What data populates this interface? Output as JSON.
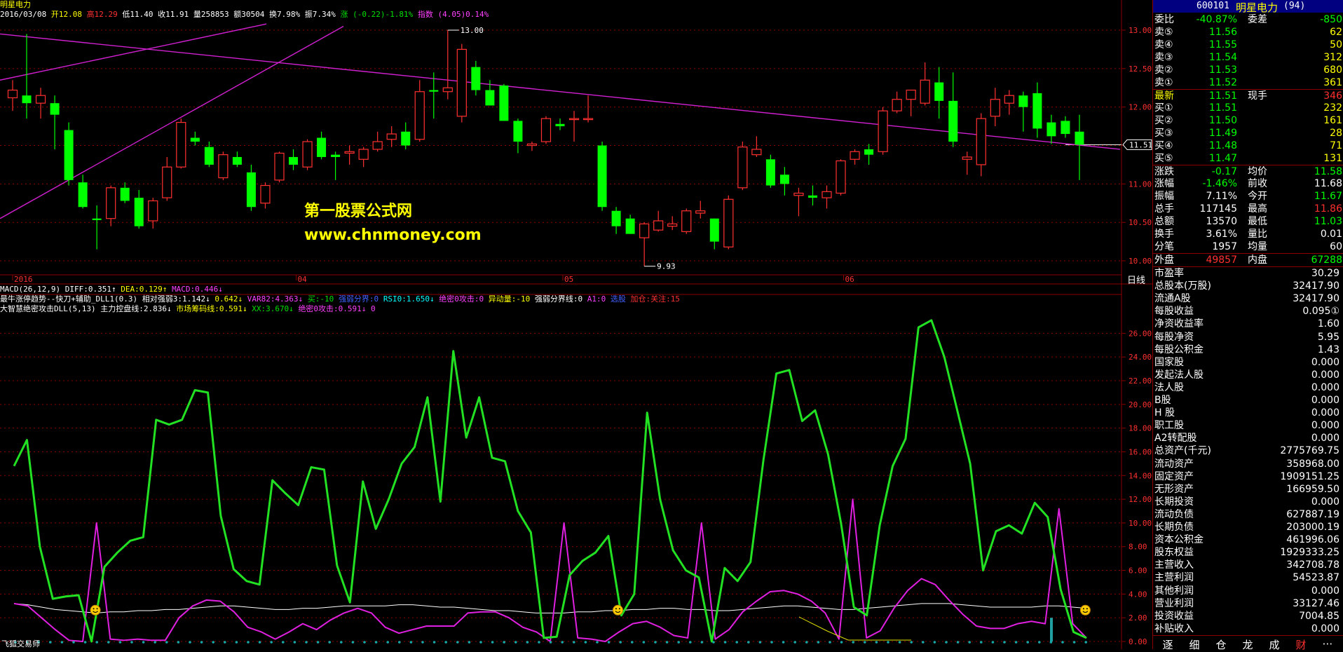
{
  "window": {
    "title": "明星电力"
  },
  "ohlc": {
    "date": "2016/03/08",
    "open_label": "开",
    "open": "12.08",
    "high_label": "高",
    "high": "12.29",
    "low_label": "低",
    "low": "11.40",
    "close_label": "收",
    "close": "11.91",
    "vol_label": "量",
    "vol": "258853",
    "amt_label": "额",
    "amt": "30504",
    "turn_label": "换",
    "turn": "7.98%",
    "amp_label": "振",
    "amp": "7.34%",
    "chg": "涨 (-0.22)-1.81%",
    "idx": "指数 (4.05)0.14%"
  },
  "overlay": {
    "line1": "第一股票公式网",
    "line2": "www.chnmoney.com"
  },
  "price_axis": {
    "ticks": [
      "13.00",
      "12.50",
      "12.00",
      "11.50",
      "11.00",
      "10.50",
      "10.00"
    ],
    "current": "11.51",
    "peak_label": "13.00",
    "trough_label": "9.93",
    "period": "日线"
  },
  "date_axis": [
    "2016",
    "04",
    "05",
    "06"
  ],
  "indicator_rows": {
    "macd": [
      "MACD(26,12,9)",
      "DIFF:0.351↑",
      "DEA:0.129↑",
      "MACD:0.446↓"
    ],
    "row2": [
      "最牛涨停趋势--快刀+辅助_DLL1(0.3)",
      "相对强弱3:1.142↓",
      "0.642↓",
      "VAR82:4.363↓",
      "买:-10",
      "强弱分界:0",
      "RSI0:1.650↓",
      "绝密0攻击:0",
      "异动量:-10",
      "强弱分界线:0",
      "A1:0",
      "选股",
      "加仓:关注:15"
    ],
    "row3": [
      "大智慧绝密攻击DLL(5,13)",
      "主力控盘线:2.836↓",
      "市场筹码线:0.591↓",
      "XX:3.670↓",
      "绝密0攻击:0.591↓",
      "0"
    ]
  },
  "sub_axis": [
    "26.00",
    "24.00",
    "22.00",
    "20.00",
    "18.00",
    "16.00",
    "14.00",
    "12.00",
    "10.00",
    "8.00",
    "6.00",
    "4.00",
    "2.00",
    "0.00"
  ],
  "footer_left": "飞狐交易师",
  "panel": {
    "code": "600101",
    "name": "明星电力",
    "count": "(94)",
    "ratio_label": "委比",
    "ratio": "-40.87%",
    "diff_label": "委差",
    "diff": "-850",
    "sell": [
      {
        "label": "卖⑤",
        "price": "11.56",
        "vol": "62"
      },
      {
        "label": "卖④",
        "price": "11.55",
        "vol": "50"
      },
      {
        "label": "卖③",
        "price": "11.54",
        "vol": "312"
      },
      {
        "label": "卖②",
        "price": "11.53",
        "vol": "680"
      },
      {
        "label": "卖①",
        "price": "11.52",
        "vol": "361"
      }
    ],
    "latest_label": "最新",
    "latest": "11.51",
    "now_label": "现手",
    "now": "346",
    "buy": [
      {
        "label": "买①",
        "price": "11.51",
        "vol": "232"
      },
      {
        "label": "买②",
        "price": "11.50",
        "vol": "161"
      },
      {
        "label": "买③",
        "price": "11.49",
        "vol": "28"
      },
      {
        "label": "买④",
        "price": "11.48",
        "vol": "71"
      },
      {
        "label": "买⑤",
        "price": "11.47",
        "vol": "131"
      }
    ],
    "stats": [
      {
        "l1": "涨跌",
        "v1": "-0.17",
        "c1": "#00ff00",
        "l2": "均价",
        "v2": "11.58",
        "c2": "#00ff00"
      },
      {
        "l1": "涨幅",
        "v1": "-1.46%",
        "c1": "#00ff00",
        "l2": "前收",
        "v2": "11.68",
        "c2": "#ffffff"
      },
      {
        "l1": "振幅",
        "v1": "7.11%",
        "c1": "#ffffff",
        "l2": "今开",
        "v2": "11.67",
        "c2": "#00ff00"
      },
      {
        "l1": "总手",
        "v1": "117145",
        "c1": "#ffffff",
        "l2": "最高",
        "v2": "11.86",
        "c2": "#ff3030"
      },
      {
        "l1": "总额",
        "v1": "13570",
        "c1": "#ffffff",
        "l2": "最低",
        "v2": "11.03",
        "c2": "#00ff00"
      },
      {
        "l1": "换手",
        "v1": "3.61%",
        "c1": "#ffffff",
        "l2": "量比",
        "v2": "0.01",
        "c2": "#ffffff"
      },
      {
        "l1": "分笔",
        "v1": "1957",
        "c1": "#ffffff",
        "l2": "均量",
        "v2": "60",
        "c2": "#ffffff"
      }
    ],
    "outer_label": "外盘",
    "outer": "49857",
    "inner_label": "内盘",
    "inner": "67288",
    "fundamentals": [
      {
        "label": "市盈率",
        "value": "30.29"
      },
      {
        "label": "总股本(万股)",
        "value": "32417.90"
      },
      {
        "label": "流通A股",
        "value": "32417.90"
      },
      {
        "label": "每股收益",
        "value": "0.095①"
      },
      {
        "label": "净资收益率",
        "value": "1.60"
      },
      {
        "label": "每股净资",
        "value": "5.95"
      },
      {
        "label": "每股公积金",
        "value": "1.43"
      },
      {
        "label": "国家股",
        "value": "0.000"
      },
      {
        "label": "发起法人股",
        "value": "0.000"
      },
      {
        "label": "法人股",
        "value": "0.000"
      },
      {
        "label": "B股",
        "value": "0.000"
      },
      {
        "label": "H 股",
        "value": "0.000"
      },
      {
        "label": "职工股",
        "value": "0.000"
      },
      {
        "label": "A2转配股",
        "value": "0.000"
      },
      {
        "label": "总资产(千元)",
        "value": "2775769.75"
      },
      {
        "label": "流动资产",
        "value": "358968.00"
      },
      {
        "label": "固定资产",
        "value": "1909151.25"
      },
      {
        "label": "无形资产",
        "value": "166959.50"
      },
      {
        "label": "长期投资",
        "value": "0.000"
      },
      {
        "label": "流动负债",
        "value": "627887.19"
      },
      {
        "label": "长期负债",
        "value": "203000.19"
      },
      {
        "label": "资本公积金",
        "value": "461996.06"
      },
      {
        "label": "股东权益",
        "value": "1929333.25"
      },
      {
        "label": "主营收入",
        "value": "342708.78"
      },
      {
        "label": "主营利润",
        "value": "54523.87"
      },
      {
        "label": "其他利润",
        "value": "0.000"
      },
      {
        "label": "营业利润",
        "value": "33127.46"
      },
      {
        "label": "投资收益",
        "value": "7004.85"
      },
      {
        "label": "补贴收入",
        "value": "0.000"
      }
    ],
    "tabs": [
      "逐",
      "细",
      "仓",
      "龙",
      "成",
      "财",
      "⋯"
    ]
  },
  "colors": {
    "up": "#ff3030",
    "down": "#00ff00",
    "bg": "#000000",
    "grid": "#8b0000",
    "magenta": "#d020d0",
    "accent": "#ffff00"
  },
  "chart_data": [
    {
      "type": "candlestick",
      "ylim": [
        9.9,
        13.1
      ],
      "candles": [
        {
          "o": 12.12,
          "h": 12.35,
          "l": 11.95,
          "c": 12.22
        },
        {
          "o": 12.15,
          "h": 12.95,
          "l": 11.85,
          "c": 12.05
        },
        {
          "o": 12.05,
          "h": 12.25,
          "l": 11.85,
          "c": 12.15
        },
        {
          "o": 12.05,
          "h": 12.15,
          "l": 11.45,
          "c": 11.9
        },
        {
          "o": 11.7,
          "h": 11.8,
          "l": 10.98,
          "c": 11.05
        },
        {
          "o": 11.02,
          "h": 11.12,
          "l": 10.68,
          "c": 10.7
        },
        {
          "o": 10.55,
          "h": 10.72,
          "l": 10.15,
          "c": 10.53
        },
        {
          "o": 10.55,
          "h": 10.98,
          "l": 10.45,
          "c": 10.95
        },
        {
          "o": 10.95,
          "h": 11.02,
          "l": 10.75,
          "c": 10.78
        },
        {
          "o": 10.82,
          "h": 10.92,
          "l": 10.42,
          "c": 10.45
        },
        {
          "o": 10.52,
          "h": 10.82,
          "l": 10.42,
          "c": 10.78
        },
        {
          "o": 10.82,
          "h": 11.35,
          "l": 10.78,
          "c": 11.22
        },
        {
          "o": 11.22,
          "h": 11.85,
          "l": 11.2,
          "c": 11.8
        },
        {
          "o": 11.6,
          "h": 11.68,
          "l": 11.5,
          "c": 11.55
        },
        {
          "o": 11.48,
          "h": 11.55,
          "l": 11.22,
          "c": 11.25
        },
        {
          "o": 11.08,
          "h": 11.42,
          "l": 11.05,
          "c": 11.38
        },
        {
          "o": 11.35,
          "h": 11.42,
          "l": 11.22,
          "c": 11.25
        },
        {
          "o": 11.15,
          "h": 11.25,
          "l": 10.65,
          "c": 10.7
        },
        {
          "o": 10.75,
          "h": 11.02,
          "l": 10.68,
          "c": 10.98
        },
        {
          "o": 11.05,
          "h": 11.42,
          "l": 11.02,
          "c": 11.4
        },
        {
          "o": 11.35,
          "h": 11.45,
          "l": 11.18,
          "c": 11.25
        },
        {
          "o": 11.22,
          "h": 11.58,
          "l": 11.18,
          "c": 11.55
        },
        {
          "o": 11.6,
          "h": 11.68,
          "l": 11.32,
          "c": 11.35
        },
        {
          "o": 11.38,
          "h": 11.42,
          "l": 11.05,
          "c": 11.35
        },
        {
          "o": 11.4,
          "h": 11.5,
          "l": 11.25,
          "c": 11.42
        },
        {
          "o": 11.32,
          "h": 11.48,
          "l": 11.22,
          "c": 11.45
        },
        {
          "o": 11.45,
          "h": 11.68,
          "l": 11.42,
          "c": 11.55
        },
        {
          "o": 11.58,
          "h": 11.75,
          "l": 11.48,
          "c": 11.65
        },
        {
          "o": 11.68,
          "h": 11.8,
          "l": 11.45,
          "c": 11.5
        },
        {
          "o": 11.58,
          "h": 12.35,
          "l": 11.55,
          "c": 12.2
        },
        {
          "o": 12.22,
          "h": 12.45,
          "l": 11.85,
          "c": 12.2
        },
        {
          "o": 12.2,
          "h": 13.0,
          "l": 12.1,
          "c": 12.25
        },
        {
          "o": 11.88,
          "h": 12.82,
          "l": 11.8,
          "c": 12.75
        },
        {
          "o": 12.52,
          "h": 12.6,
          "l": 12.15,
          "c": 12.22
        },
        {
          "o": 12.22,
          "h": 12.35,
          "l": 12.05,
          "c": 12.02
        },
        {
          "o": 12.28,
          "h": 12.3,
          "l": 11.82,
          "c": 11.82
        },
        {
          "o": 11.82,
          "h": 11.85,
          "l": 11.4,
          "c": 11.55
        },
        {
          "o": 11.5,
          "h": 11.55,
          "l": 11.43,
          "c": 11.52
        },
        {
          "o": 11.55,
          "h": 11.88,
          "l": 11.52,
          "c": 11.85
        },
        {
          "o": 11.78,
          "h": 11.85,
          "l": 11.7,
          "c": 11.75
        },
        {
          "o": 11.85,
          "h": 11.95,
          "l": 11.55,
          "c": 11.85
        },
        {
          "o": 11.84,
          "h": 12.15,
          "l": 11.8,
          "c": 11.85
        },
        {
          "o": 11.5,
          "h": 11.55,
          "l": 10.65,
          "c": 10.7
        },
        {
          "o": 10.65,
          "h": 10.7,
          "l": 10.35,
          "c": 10.45
        },
        {
          "o": 10.55,
          "h": 10.6,
          "l": 10.35,
          "c": 10.35
        },
        {
          "o": 10.3,
          "h": 10.5,
          "l": 9.93,
          "c": 10.48
        },
        {
          "o": 10.4,
          "h": 10.65,
          "l": 10.38,
          "c": 10.52
        },
        {
          "o": 10.45,
          "h": 10.58,
          "l": 10.4,
          "c": 10.48
        },
        {
          "o": 10.38,
          "h": 10.68,
          "l": 10.35,
          "c": 10.65
        },
        {
          "o": 10.62,
          "h": 10.78,
          "l": 10.55,
          "c": 10.65
        },
        {
          "o": 10.55,
          "h": 10.55,
          "l": 10.15,
          "c": 10.25
        },
        {
          "o": 10.18,
          "h": 10.85,
          "l": 10.15,
          "c": 10.8
        },
        {
          "o": 10.95,
          "h": 11.55,
          "l": 10.92,
          "c": 11.48
        },
        {
          "o": 11.38,
          "h": 11.62,
          "l": 11.35,
          "c": 11.45
        },
        {
          "o": 11.32,
          "h": 11.38,
          "l": 10.95,
          "c": 10.98
        },
        {
          "o": 11.12,
          "h": 11.22,
          "l": 10.85,
          "c": 11.0
        },
        {
          "o": 10.85,
          "h": 10.95,
          "l": 10.58,
          "c": 10.88
        },
        {
          "o": 10.85,
          "h": 10.98,
          "l": 10.72,
          "c": 10.82
        },
        {
          "o": 10.82,
          "h": 10.98,
          "l": 10.68,
          "c": 10.9
        },
        {
          "o": 10.88,
          "h": 11.32,
          "l": 10.85,
          "c": 11.3
        },
        {
          "o": 11.32,
          "h": 11.45,
          "l": 11.25,
          "c": 11.42
        },
        {
          "o": 11.45,
          "h": 11.52,
          "l": 11.25,
          "c": 11.38
        },
        {
          "o": 11.42,
          "h": 12.0,
          "l": 11.38,
          "c": 11.95
        },
        {
          "o": 11.95,
          "h": 12.2,
          "l": 11.92,
          "c": 12.1
        },
        {
          "o": 12.1,
          "h": 12.22,
          "l": 11.88,
          "c": 12.22
        },
        {
          "o": 12.05,
          "h": 12.58,
          "l": 12.02,
          "c": 12.35
        },
        {
          "o": 12.32,
          "h": 12.52,
          "l": 11.85,
          "c": 12.08
        },
        {
          "o": 12.08,
          "h": 12.45,
          "l": 11.48,
          "c": 11.55
        },
        {
          "o": 11.32,
          "h": 11.42,
          "l": 11.12,
          "c": 11.35
        },
        {
          "o": 11.25,
          "h": 11.92,
          "l": 11.1,
          "c": 11.85
        },
        {
          "o": 11.88,
          "h": 12.25,
          "l": 11.75,
          "c": 12.1
        },
        {
          "o": 12.05,
          "h": 12.22,
          "l": 11.9,
          "c": 12.15
        },
        {
          "o": 12.15,
          "h": 12.2,
          "l": 11.68,
          "c": 12.0
        },
        {
          "o": 12.18,
          "h": 12.32,
          "l": 11.6,
          "c": 11.72
        },
        {
          "o": 11.8,
          "h": 11.9,
          "l": 11.52,
          "c": 11.62
        },
        {
          "o": 11.82,
          "h": 11.88,
          "l": 11.6,
          "c": 11.65
        },
        {
          "o": 11.68,
          "h": 11.9,
          "l": 11.05,
          "c": 11.51
        }
      ]
    },
    {
      "type": "line",
      "ylim": [
        0,
        27.5
      ],
      "series": [
        {
          "values": [
            14.8,
            17.0,
            8.0,
            3.6,
            3.8,
            3.9,
            0,
            6.3,
            7.5,
            8.5,
            8.8,
            18.7,
            18.3,
            18.7,
            21.2,
            21.0,
            10.6,
            6.1,
            5.1,
            4.8,
            13.6,
            12.5,
            11.5,
            14.7,
            14.5,
            6.4,
            3.3,
            13.5,
            9.5,
            12.0,
            15.0,
            16.4,
            20.6,
            11.8,
            24.5,
            17.2,
            20.6,
            15.5,
            15.2,
            11.0,
            9.2,
            0.3,
            0.4,
            5.6,
            6.8,
            7.5,
            8.9,
            2.2,
            4.0,
            19.3,
            12.0,
            7.7,
            6.0,
            5.4,
            0.0,
            6.2,
            5.1,
            6.7,
            15.3,
            22.6,
            22.9,
            18.6,
            19.5,
            15.8,
            10.0,
            2.9,
            2.2,
            9.8,
            14.8,
            17.1,
            26.5,
            27.1,
            24.0,
            19.5,
            15.0,
            6.0,
            9.3,
            9.8,
            9.1,
            11.7,
            10.5,
            4.4,
            0.8,
            0.3
          ]
        },
        {
          "values": [
            3.2,
            3.0,
            2.0,
            1.0,
            0.1,
            0.0,
            10.0,
            0.2,
            0.1,
            0.2,
            0.1,
            0.1,
            2.0,
            3.0,
            3.5,
            3.4,
            2.5,
            1.2,
            0.8,
            0.2,
            0.8,
            1.5,
            1.0,
            1.8,
            2.4,
            2.8,
            2.4,
            1.2,
            0.7,
            1.0,
            1.3,
            1.3,
            1.3,
            2.4,
            2.5,
            2.5,
            2.0,
            1.2,
            0.8,
            0.0,
            10.0,
            0.3,
            0.2,
            0.0,
            0.8,
            1.5,
            1.7,
            1.2,
            0.5,
            0.3,
            10.0,
            0.2,
            1.0,
            2.5,
            3.4,
            4.2,
            4.3,
            4.0,
            3.4,
            2.4,
            0.2,
            12.0,
            0.3,
            0.9,
            2.8,
            4.3,
            5.3,
            4.8,
            3.5,
            2.3,
            1.3,
            1.1,
            1.1,
            1.5,
            1.7,
            1.5,
            11.2,
            1.5,
            0.3
          ]
        },
        {
          "values": [
            3.2,
            3.1,
            2.9,
            2.7,
            2.6,
            2.5,
            2.4,
            2.5,
            2.5,
            2.6,
            2.6,
            2.7,
            2.7,
            2.8,
            2.9,
            3.0,
            3.0,
            2.9,
            2.8,
            2.7,
            2.7,
            2.8,
            2.8,
            2.9,
            3.0,
            3.0,
            3.0,
            3.0,
            3.1,
            3.1,
            3.0,
            2.9,
            2.9,
            2.8,
            2.7,
            2.6,
            2.6,
            2.5,
            2.4,
            2.4,
            2.4,
            2.5,
            2.5,
            2.6,
            2.6,
            2.7,
            2.7,
            2.8,
            2.8,
            2.7,
            2.7,
            2.6,
            2.6,
            2.7,
            2.8,
            2.9,
            3.0,
            3.0,
            2.9,
            2.8,
            2.7,
            2.7,
            2.8,
            2.9,
            3.0,
            3.1,
            3.2,
            3.2,
            3.2,
            3.1,
            3.0,
            2.9,
            2.9,
            2.9,
            2.9,
            3.0,
            3.0,
            2.9,
            2.8
          ]
        }
      ]
    }
  ]
}
